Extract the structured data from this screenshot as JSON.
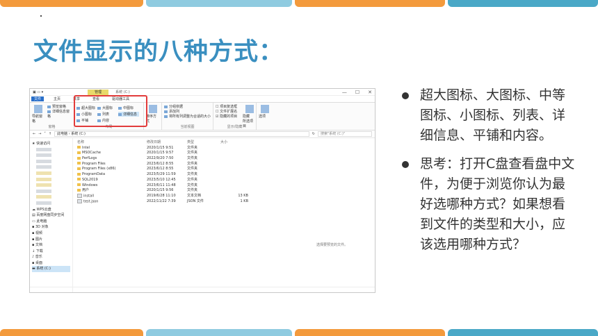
{
  "slide": {
    "title": "文件显示的八种方式：",
    "bullets": [
      "超大图标、大图标、中等图标、小图标、列表、详细信息、平铺和内容。",
      "思考：打开C盘查看盘中文件，为便于浏览你认为最好选哪种方式？如果想看到文件的类型和大小，应该选用哪种方式？"
    ]
  },
  "colors": {
    "title": "#3a8fc0",
    "orange": "#f39a3c",
    "teal": "#4aa8c7",
    "lightblue": "#8fcbe0",
    "highlight": "#e23b3b"
  },
  "explorer": {
    "title_ctx": "管理",
    "title_text": "系统 (C:)",
    "window_controls": [
      "—",
      "☐",
      "✕"
    ],
    "tabs": [
      "文件",
      "主页",
      "共享",
      "查看",
      "驱动器工具"
    ],
    "ribbon": {
      "pane_group": {
        "nav_pane": "导航窗格",
        "preview": "预览窗格",
        "details": "详细信息窗格",
        "caption": "窗格"
      },
      "layout_group": {
        "items": [
          "超大图标",
          "大图标",
          "中图标",
          "小图标",
          "列表",
          "详细信息",
          "平铺",
          "内容"
        ],
        "caption": "布局"
      },
      "sort": "排序方式",
      "view_group": {
        "group_by": "分组依据",
        "add_column": "添加列",
        "fit_columns": "将所有列调整为合适的大小",
        "caption": "当前视图"
      },
      "show_group": {
        "checkbox": "项目复选框",
        "extensions": "文件扩展名",
        "hidden": "隐藏的项目",
        "hide_sel": "隐藏",
        "hide_sel2": "所选项目",
        "caption": "显示/隐藏"
      },
      "options": "选项"
    },
    "address": {
      "path": "此电脑 › 系统 (C:)",
      "search_placeholder": "搜索\"系统 (C:)\""
    },
    "nav": {
      "quick_access": "快速访问",
      "wps": "WPS云盘",
      "baidu": "百度网盘同步空间",
      "this_pc": "此电脑",
      "items": [
        "3D 对象",
        "视频",
        "图片",
        "文档",
        "下载",
        "音乐",
        "桌面",
        "系统 (C:)"
      ]
    },
    "columns": [
      "名称",
      "修改日期",
      "类型",
      "大小"
    ],
    "files": [
      {
        "name": "Intel",
        "date": "2020/1/15 9:51",
        "type": "文件夹",
        "size": "",
        "doc": false
      },
      {
        "name": "MSOCache",
        "date": "2020/1/15 9:57",
        "type": "文件夹",
        "size": "",
        "doc": false
      },
      {
        "name": "PerfLogs",
        "date": "2022/9/20 7:50",
        "type": "文件夹",
        "size": "",
        "doc": false
      },
      {
        "name": "Program Files",
        "date": "2023/6/12 8:55",
        "type": "文件夹",
        "size": "",
        "doc": false
      },
      {
        "name": "Program Files (x86)",
        "date": "2023/6/12 8:55",
        "type": "文件夹",
        "size": "",
        "doc": false
      },
      {
        "name": "ProgramData",
        "date": "2023/5/29 11:59",
        "type": "文件夹",
        "size": "",
        "doc": false
      },
      {
        "name": "SQL2019",
        "date": "2023/5/10 12:45",
        "type": "文件夹",
        "size": "",
        "doc": false
      },
      {
        "name": "Windows",
        "date": "2023/6/11 11:48",
        "type": "文件夹",
        "size": "",
        "doc": false
      },
      {
        "name": "用户",
        "date": "2020/1/15 9:56",
        "type": "文件夹",
        "size": "",
        "doc": false
      },
      {
        "name": "install",
        "date": "2019/6/28 11:10",
        "type": "文本文档",
        "size": "13 KB",
        "doc": true
      },
      {
        "name": "test.json",
        "date": "2022/11/22 7:39",
        "type": "JSON 文件",
        "size": "1 KB",
        "doc": true
      }
    ],
    "empty_hint": "选择要预览的文件。"
  }
}
